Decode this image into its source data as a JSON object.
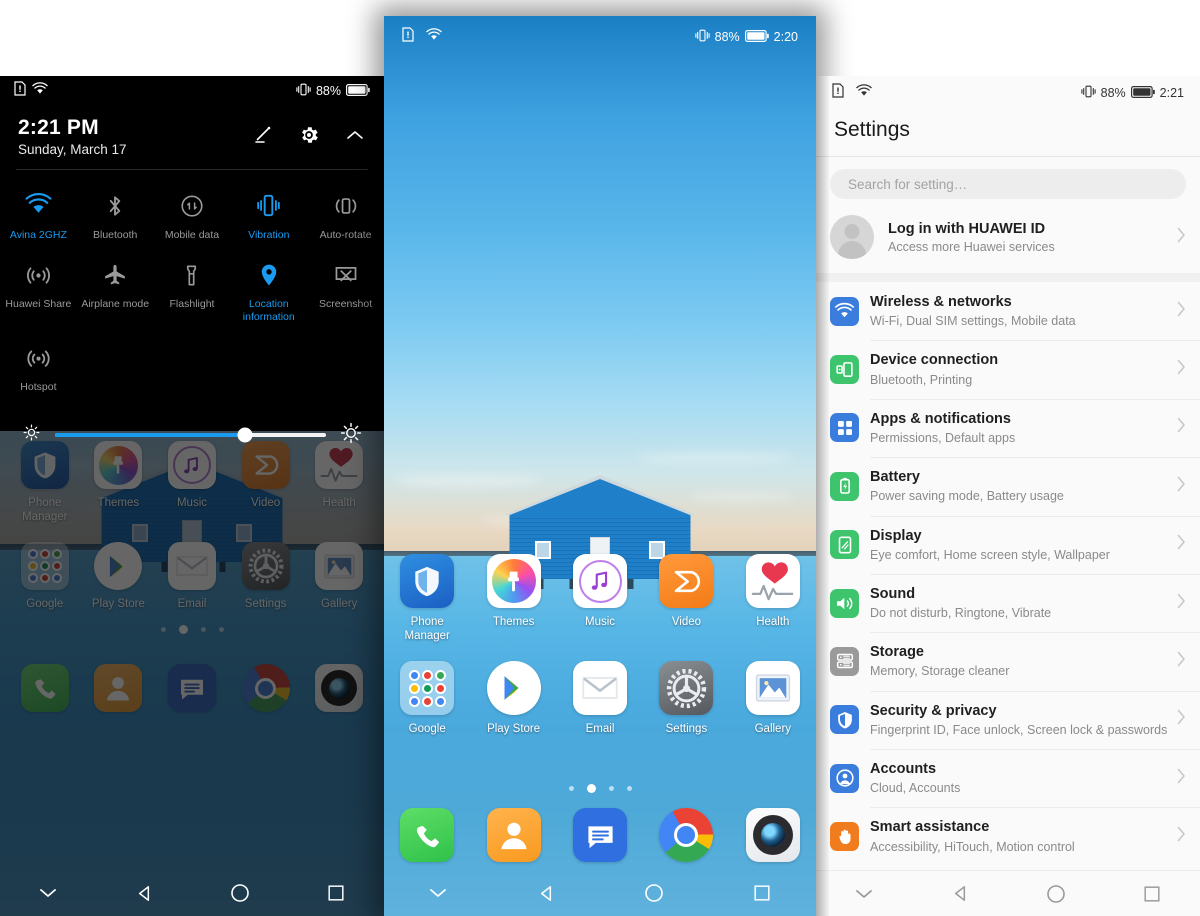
{
  "colors": {
    "accent_blue": "#1a9bf0",
    "shade_bg": "#000000",
    "settings_bg": "#fafafa",
    "wallpaper_sky": "#4aa9e0",
    "icon_blue": "#3b7ddd",
    "icon_green": "#3ec46d",
    "icon_orange": "#f07c1e"
  },
  "left_panel": {
    "name": "notification-shade",
    "status_bar": {
      "sim_icon": "sim-alert-icon",
      "wifi_icon": "wifi-icon",
      "vibrate_icon": "vibrate-icon",
      "battery_percent": "88%",
      "battery_icon": "battery-icon"
    },
    "clock": {
      "time": "2:21 PM",
      "date": "Sunday, March 17"
    },
    "header_actions": [
      {
        "name": "edit-icon",
        "label": "Edit"
      },
      {
        "name": "gear-icon",
        "label": "Settings"
      },
      {
        "name": "chevron-up-icon",
        "label": "Collapse"
      }
    ],
    "tiles": [
      {
        "label": "Avina 2GHZ",
        "icon": "wifi-icon",
        "active": true
      },
      {
        "label": "Bluetooth",
        "icon": "bluetooth-icon",
        "active": false
      },
      {
        "label": "Mobile data",
        "icon": "mobile-data-icon",
        "active": false
      },
      {
        "label": "Vibration",
        "icon": "vibration-icon",
        "active": true
      },
      {
        "label": "Auto-rotate",
        "icon": "auto-rotate-icon",
        "active": false
      },
      {
        "label": "Huawei Share",
        "icon": "huawei-share-icon",
        "active": false
      },
      {
        "label": "Airplane mode",
        "icon": "airplane-icon",
        "active": false
      },
      {
        "label": "Flashlight",
        "icon": "flashlight-icon",
        "active": false
      },
      {
        "label": "Location information",
        "icon": "location-pin-icon",
        "active": true
      },
      {
        "label": "Screenshot",
        "icon": "screenshot-icon",
        "active": false
      },
      {
        "label": "Hotspot",
        "icon": "hotspot-icon",
        "active": false
      }
    ],
    "brightness": {
      "low_icon": "brightness-low-icon",
      "high_icon": "brightness-high-icon",
      "value_percent": 70
    },
    "nav_bar": {
      "collapse_icon": "chevron-down-icon",
      "back_icon": "back-triangle-icon",
      "home_icon": "home-circle-icon",
      "recents_icon": "recents-square-icon"
    }
  },
  "center_panel": {
    "name": "home-screen",
    "status_bar": {
      "sim_icon": "sim-alert-icon",
      "wifi_icon": "wifi-icon",
      "vibrate_icon": "vibrate-icon",
      "battery_percent": "88%",
      "battery_icon": "battery-icon",
      "time": "2:20"
    },
    "rows": [
      [
        {
          "label": "Phone Manager",
          "icon": "shield-icon"
        },
        {
          "label": "Themes",
          "icon": "paintbrush-icon"
        },
        {
          "label": "Music",
          "icon": "music-note-icon"
        },
        {
          "label": "Video",
          "icon": "play-triangle-icon"
        },
        {
          "label": "Health",
          "icon": "heart-pulse-icon"
        }
      ],
      [
        {
          "label": "Google",
          "icon": "google-folder-icon"
        },
        {
          "label": "Play Store",
          "icon": "play-store-icon"
        },
        {
          "label": "Email",
          "icon": "envelope-icon"
        },
        {
          "label": "Settings",
          "icon": "gear-icon"
        },
        {
          "label": "Gallery",
          "icon": "photo-icon"
        }
      ]
    ],
    "dock": [
      {
        "label": "Phone",
        "icon": "phone-handset-icon"
      },
      {
        "label": "Contacts",
        "icon": "contacts-person-icon"
      },
      {
        "label": "Messages",
        "icon": "message-bubble-icon"
      },
      {
        "label": "Chrome",
        "icon": "chrome-icon"
      },
      {
        "label": "Camera",
        "icon": "camera-lens-icon"
      }
    ],
    "page_dots": {
      "count": 4,
      "active_index": 1
    },
    "nav_bar": {
      "collapse_icon": "chevron-down-icon",
      "back_icon": "back-triangle-icon",
      "home_icon": "home-circle-icon",
      "recents_icon": "recents-square-icon"
    }
  },
  "right_panel": {
    "name": "settings-app",
    "status_bar": {
      "sim_icon": "sim-alert-icon",
      "wifi_icon": "wifi-icon",
      "vibrate_icon": "vibrate-icon",
      "battery_percent": "88%",
      "battery_icon": "battery-icon",
      "time": "2:21"
    },
    "title": "Settings",
    "search": {
      "placeholder": "Search for setting…",
      "value": ""
    },
    "account": {
      "title": "Log in with HUAWEI ID",
      "subtitle": "Access more Huawei services",
      "avatar": "avatar-placeholder-icon",
      "chevron": "chevron-right-icon"
    },
    "items": [
      {
        "title": "Wireless & networks",
        "subtitle": "Wi-Fi, Dual SIM settings, Mobile data",
        "icon": "wifi-icon",
        "color": "#3b7ddd"
      },
      {
        "title": "Device connection",
        "subtitle": "Bluetooth, Printing",
        "icon": "device-connection-icon",
        "color": "#3ec46d"
      },
      {
        "title": "Apps & notifications",
        "subtitle": "Permissions, Default apps",
        "icon": "apps-grid-icon",
        "color": "#3b7ddd"
      },
      {
        "title": "Battery",
        "subtitle": "Power saving mode, Battery usage",
        "icon": "battery-icon",
        "color": "#3ec46d"
      },
      {
        "title": "Display",
        "subtitle": "Eye comfort, Home screen style, Wallpaper",
        "icon": "display-icon",
        "color": "#3ec46d"
      },
      {
        "title": "Sound",
        "subtitle": "Do not disturb, Ringtone, Vibrate",
        "icon": "speaker-icon",
        "color": "#3ec46d"
      },
      {
        "title": "Storage",
        "subtitle": "Memory, Storage cleaner",
        "icon": "storage-icon",
        "color": "#9a9a9a"
      },
      {
        "title": "Security & privacy",
        "subtitle": "Fingerprint ID, Face unlock, Screen lock & passwords",
        "icon": "shield-icon",
        "color": "#3b7ddd"
      },
      {
        "title": "Accounts",
        "subtitle": "Cloud, Accounts",
        "icon": "account-circle-icon",
        "color": "#3b7ddd"
      },
      {
        "title": "Smart assistance",
        "subtitle": "Accessibility, HiTouch, Motion control",
        "icon": "hand-icon",
        "color": "#f07c1e"
      }
    ],
    "nav_bar": {
      "collapse_icon": "chevron-down-icon",
      "back_icon": "back-triangle-icon",
      "home_icon": "home-circle-icon",
      "recents_icon": "recents-square-icon"
    }
  }
}
